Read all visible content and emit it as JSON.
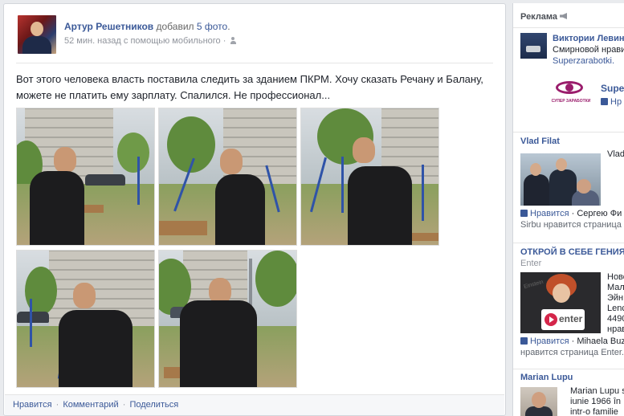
{
  "post": {
    "author": "Артур Решетников",
    "action_prefix": "добавил",
    "action_count": "5 фото",
    "action_suffix": ".",
    "time": "52 мин. назад с помощью мобильного",
    "time_sep": "·",
    "text": "Вот этого человека власть поставила следить за зданием ПКРМ. Хочу сказать Речану и Балану, можете не платить ему зарплату. Спалился. Не профессионал...",
    "photos_count": 5,
    "actions": {
      "like": "Нравится",
      "comment": "Комментарий",
      "share": "Поделиться",
      "separator": "·"
    }
  },
  "sidebar": {
    "ads_title": "Реклама",
    "ad1": {
      "name": "Виктории Левин",
      "line2": "Смирновой нравится",
      "line3": "Superzarabotki."
    },
    "ad2": {
      "name": "Super",
      "like": "Нр",
      "logo_text": "СУПЕР ЗАРАБОТКИ"
    },
    "vlad": {
      "title": "Vlad Filat",
      "side": "Vlad",
      "like": "Нравится",
      "like_line": "· Сергею Фи",
      "line2": "Sirbu нравится страница V"
    },
    "enter": {
      "title": "ОТКРОЙ В СЕБЕ ГЕНИЯ!",
      "sub": "Enter",
      "side_lines": [
        "Ново",
        "Мало",
        "Эйн",
        "Lenc",
        "4490",
        "нрав"
      ],
      "logo": "enter",
      "like": "Нравится",
      "like_line": "· Mihaela Buz",
      "line2": "нравится страница Enter."
    },
    "lupu": {
      "title": "Marian Lupu",
      "side_lines": [
        "Marian Lupu s",
        "iunie 1966 în",
        "intr-o familie"
      ]
    }
  }
}
